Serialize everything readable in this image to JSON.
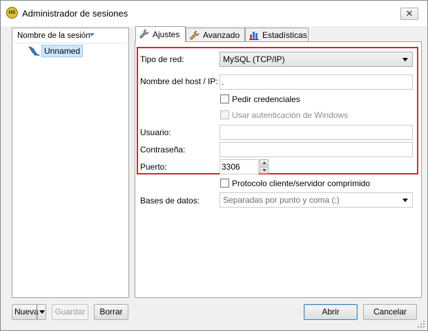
{
  "window": {
    "title": "Administrador de sesiones",
    "close_glyph": "✕"
  },
  "app_icon": {
    "name": "heidisql-icon",
    "text": "HS"
  },
  "session_tree": {
    "column_header": "Nombre de la sesión",
    "sessions": [
      {
        "label": "Unnamed",
        "icon": "dolphin-icon",
        "selected": true
      }
    ]
  },
  "tabs": [
    {
      "label": "Ajustes",
      "icon": "wrench-icon",
      "active": true
    },
    {
      "label": "Avanzado",
      "icon": "wrench-icon",
      "active": false
    },
    {
      "label": "Estadísticas",
      "icon": "bar-chart-icon",
      "active": false
    }
  ],
  "settings": {
    "network_type": {
      "label": "Tipo de red:",
      "value": "MySQL (TCP/IP)"
    },
    "hostname": {
      "label": "Nombre del host / IP:",
      "value": "."
    },
    "prompt_credentials": {
      "label": "Pedir credenciales",
      "checked": false
    },
    "windows_auth": {
      "label": "Usar autenticación de Windows",
      "checked": false,
      "disabled": true
    },
    "user": {
      "label": "Usuario:",
      "value": ""
    },
    "password": {
      "label": "Contraseña:",
      "value": ""
    },
    "port": {
      "label": "Puerto:",
      "value": "3306"
    },
    "compressed": {
      "label": "Protocolo cliente/servidor comprimido",
      "checked": false
    },
    "databases": {
      "label": "Bases de datos:",
      "placeholder": "Separadas por punto y coma (;)"
    }
  },
  "buttons": {
    "new": "Nueva",
    "save": "Guardar",
    "delete": "Borrar",
    "open": "Abrir",
    "cancel": "Cancelar"
  },
  "colors": {
    "highlight": "#e12020",
    "selection": "#cce8ff",
    "accent": "#3c7fb1"
  }
}
